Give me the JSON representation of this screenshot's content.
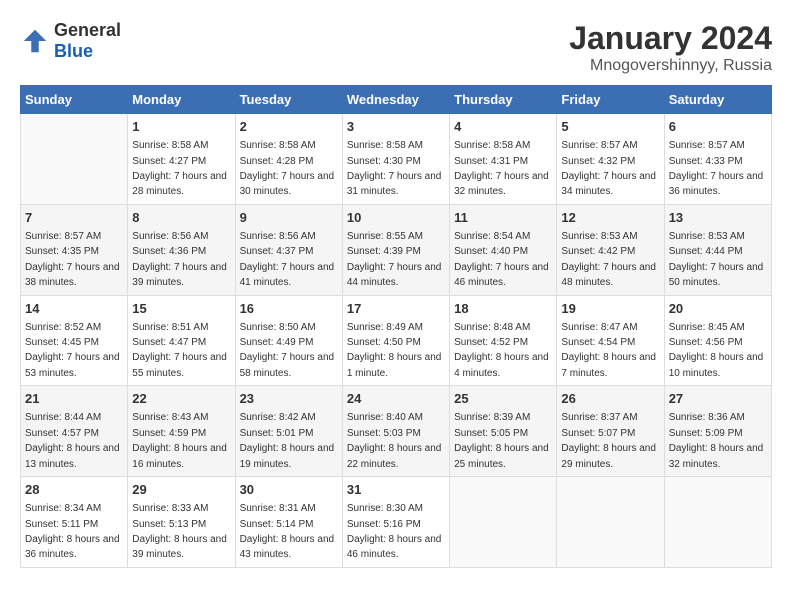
{
  "header": {
    "logo_general": "General",
    "logo_blue": "Blue",
    "month": "January 2024",
    "location": "Mnogovershinnyy, Russia"
  },
  "weekdays": [
    "Sunday",
    "Monday",
    "Tuesday",
    "Wednesday",
    "Thursday",
    "Friday",
    "Saturday"
  ],
  "weeks": [
    [
      {
        "day": "",
        "sunrise": "",
        "sunset": "",
        "daylight": ""
      },
      {
        "day": "1",
        "sunrise": "Sunrise: 8:58 AM",
        "sunset": "Sunset: 4:27 PM",
        "daylight": "Daylight: 7 hours and 28 minutes."
      },
      {
        "day": "2",
        "sunrise": "Sunrise: 8:58 AM",
        "sunset": "Sunset: 4:28 PM",
        "daylight": "Daylight: 7 hours and 30 minutes."
      },
      {
        "day": "3",
        "sunrise": "Sunrise: 8:58 AM",
        "sunset": "Sunset: 4:30 PM",
        "daylight": "Daylight: 7 hours and 31 minutes."
      },
      {
        "day": "4",
        "sunrise": "Sunrise: 8:58 AM",
        "sunset": "Sunset: 4:31 PM",
        "daylight": "Daylight: 7 hours and 32 minutes."
      },
      {
        "day": "5",
        "sunrise": "Sunrise: 8:57 AM",
        "sunset": "Sunset: 4:32 PM",
        "daylight": "Daylight: 7 hours and 34 minutes."
      },
      {
        "day": "6",
        "sunrise": "Sunrise: 8:57 AM",
        "sunset": "Sunset: 4:33 PM",
        "daylight": "Daylight: 7 hours and 36 minutes."
      }
    ],
    [
      {
        "day": "7",
        "sunrise": "Sunrise: 8:57 AM",
        "sunset": "Sunset: 4:35 PM",
        "daylight": "Daylight: 7 hours and 38 minutes."
      },
      {
        "day": "8",
        "sunrise": "Sunrise: 8:56 AM",
        "sunset": "Sunset: 4:36 PM",
        "daylight": "Daylight: 7 hours and 39 minutes."
      },
      {
        "day": "9",
        "sunrise": "Sunrise: 8:56 AM",
        "sunset": "Sunset: 4:37 PM",
        "daylight": "Daylight: 7 hours and 41 minutes."
      },
      {
        "day": "10",
        "sunrise": "Sunrise: 8:55 AM",
        "sunset": "Sunset: 4:39 PM",
        "daylight": "Daylight: 7 hours and 44 minutes."
      },
      {
        "day": "11",
        "sunrise": "Sunrise: 8:54 AM",
        "sunset": "Sunset: 4:40 PM",
        "daylight": "Daylight: 7 hours and 46 minutes."
      },
      {
        "day": "12",
        "sunrise": "Sunrise: 8:53 AM",
        "sunset": "Sunset: 4:42 PM",
        "daylight": "Daylight: 7 hours and 48 minutes."
      },
      {
        "day": "13",
        "sunrise": "Sunrise: 8:53 AM",
        "sunset": "Sunset: 4:44 PM",
        "daylight": "Daylight: 7 hours and 50 minutes."
      }
    ],
    [
      {
        "day": "14",
        "sunrise": "Sunrise: 8:52 AM",
        "sunset": "Sunset: 4:45 PM",
        "daylight": "Daylight: 7 hours and 53 minutes."
      },
      {
        "day": "15",
        "sunrise": "Sunrise: 8:51 AM",
        "sunset": "Sunset: 4:47 PM",
        "daylight": "Daylight: 7 hours and 55 minutes."
      },
      {
        "day": "16",
        "sunrise": "Sunrise: 8:50 AM",
        "sunset": "Sunset: 4:49 PM",
        "daylight": "Daylight: 7 hours and 58 minutes."
      },
      {
        "day": "17",
        "sunrise": "Sunrise: 8:49 AM",
        "sunset": "Sunset: 4:50 PM",
        "daylight": "Daylight: 8 hours and 1 minute."
      },
      {
        "day": "18",
        "sunrise": "Sunrise: 8:48 AM",
        "sunset": "Sunset: 4:52 PM",
        "daylight": "Daylight: 8 hours and 4 minutes."
      },
      {
        "day": "19",
        "sunrise": "Sunrise: 8:47 AM",
        "sunset": "Sunset: 4:54 PM",
        "daylight": "Daylight: 8 hours and 7 minutes."
      },
      {
        "day": "20",
        "sunrise": "Sunrise: 8:45 AM",
        "sunset": "Sunset: 4:56 PM",
        "daylight": "Daylight: 8 hours and 10 minutes."
      }
    ],
    [
      {
        "day": "21",
        "sunrise": "Sunrise: 8:44 AM",
        "sunset": "Sunset: 4:57 PM",
        "daylight": "Daylight: 8 hours and 13 minutes."
      },
      {
        "day": "22",
        "sunrise": "Sunrise: 8:43 AM",
        "sunset": "Sunset: 4:59 PM",
        "daylight": "Daylight: 8 hours and 16 minutes."
      },
      {
        "day": "23",
        "sunrise": "Sunrise: 8:42 AM",
        "sunset": "Sunset: 5:01 PM",
        "daylight": "Daylight: 8 hours and 19 minutes."
      },
      {
        "day": "24",
        "sunrise": "Sunrise: 8:40 AM",
        "sunset": "Sunset: 5:03 PM",
        "daylight": "Daylight: 8 hours and 22 minutes."
      },
      {
        "day": "25",
        "sunrise": "Sunrise: 8:39 AM",
        "sunset": "Sunset: 5:05 PM",
        "daylight": "Daylight: 8 hours and 25 minutes."
      },
      {
        "day": "26",
        "sunrise": "Sunrise: 8:37 AM",
        "sunset": "Sunset: 5:07 PM",
        "daylight": "Daylight: 8 hours and 29 minutes."
      },
      {
        "day": "27",
        "sunrise": "Sunrise: 8:36 AM",
        "sunset": "Sunset: 5:09 PM",
        "daylight": "Daylight: 8 hours and 32 minutes."
      }
    ],
    [
      {
        "day": "28",
        "sunrise": "Sunrise: 8:34 AM",
        "sunset": "Sunset: 5:11 PM",
        "daylight": "Daylight: 8 hours and 36 minutes."
      },
      {
        "day": "29",
        "sunrise": "Sunrise: 8:33 AM",
        "sunset": "Sunset: 5:13 PM",
        "daylight": "Daylight: 8 hours and 39 minutes."
      },
      {
        "day": "30",
        "sunrise": "Sunrise: 8:31 AM",
        "sunset": "Sunset: 5:14 PM",
        "daylight": "Daylight: 8 hours and 43 minutes."
      },
      {
        "day": "31",
        "sunrise": "Sunrise: 8:30 AM",
        "sunset": "Sunset: 5:16 PM",
        "daylight": "Daylight: 8 hours and 46 minutes."
      },
      {
        "day": "",
        "sunrise": "",
        "sunset": "",
        "daylight": ""
      },
      {
        "day": "",
        "sunrise": "",
        "sunset": "",
        "daylight": ""
      },
      {
        "day": "",
        "sunrise": "",
        "sunset": "",
        "daylight": ""
      }
    ]
  ]
}
